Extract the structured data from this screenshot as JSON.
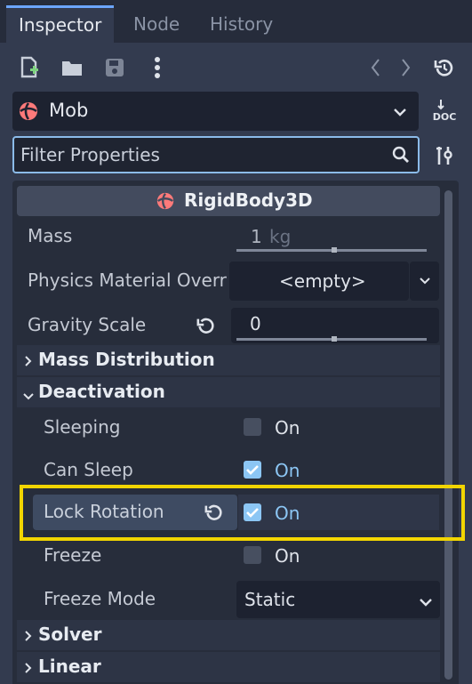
{
  "tabs": [
    {
      "label": "Inspector",
      "active": true
    },
    {
      "label": "Node",
      "active": false
    },
    {
      "label": "History",
      "active": false
    }
  ],
  "toolbar": {
    "icons": [
      "new-script-icon",
      "open-folder-icon",
      "save-icon",
      "more-vert-icon",
      "back-icon",
      "forward-icon",
      "history-icon"
    ]
  },
  "object_selector": {
    "value": "Mob",
    "doc_label": "DOC"
  },
  "filter": {
    "placeholder": "Filter Properties"
  },
  "header": {
    "title": "RigidBody3D"
  },
  "rows": {
    "mass": {
      "label": "Mass",
      "value": "1",
      "unit": "kg"
    },
    "physics_material": {
      "label": "Physics Material Overr",
      "value": "<empty>"
    },
    "gravity_scale": {
      "label": "Gravity Scale",
      "value": "0"
    },
    "mass_distribution": {
      "label": "Mass Distribution"
    },
    "deactivation": {
      "label": "Deactivation"
    },
    "sleeping": {
      "label": "Sleeping",
      "value": "On",
      "checked": false
    },
    "can_sleep": {
      "label": "Can Sleep",
      "value": "On",
      "checked": true
    },
    "lock_rotation": {
      "label": "Lock Rotation",
      "value": "On",
      "checked": true
    },
    "freeze": {
      "label": "Freeze",
      "value": "On",
      "checked": false
    },
    "freeze_mode": {
      "label": "Freeze Mode",
      "value": "Static"
    },
    "solver": {
      "label": "Solver"
    },
    "linear": {
      "label": "Linear"
    }
  },
  "colors": {
    "accent": "#8cc6f4",
    "highlight": "#f2d500",
    "node_icon": "#ff7a7a"
  }
}
